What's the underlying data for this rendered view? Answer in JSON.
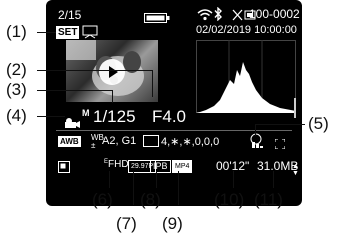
{
  "top_bar": {
    "counter": "2/15",
    "file_number": "100-0002",
    "date_time": "02/02/2019 10:00:00"
  },
  "settings": {
    "shutter": "1/125",
    "aperture": "F4.0",
    "white_balance": "AWB",
    "wb_shift": "A2, G1",
    "picture_style": "4,∗,∗,0,0,0",
    "movie_mode": "M"
  },
  "movie_info": {
    "size": "FHD",
    "frame_rate": "29.97P",
    "compression": "IPB",
    "format": "MP4",
    "duration": "00'12\"",
    "file_size": "31.0MB"
  },
  "callouts": {
    "c1": "(1)",
    "c2": "(2)",
    "c3": "(3)",
    "c4": "(4)",
    "c5": "(5)",
    "c6": "(6)",
    "c7": "(7)",
    "c8": "(8)",
    "c9": "(9)",
    "c10": "(10)",
    "c11": "(11)"
  },
  "icons": {
    "set": "SET",
    "battery": "battery-icon",
    "wifi": "wifi-icon",
    "bluetooth": "bluetooth-icon",
    "protect": "protect-icon",
    "play": "play-icon"
  },
  "colors": {
    "screen_bg": "#000000",
    "text": "#ffffff"
  }
}
